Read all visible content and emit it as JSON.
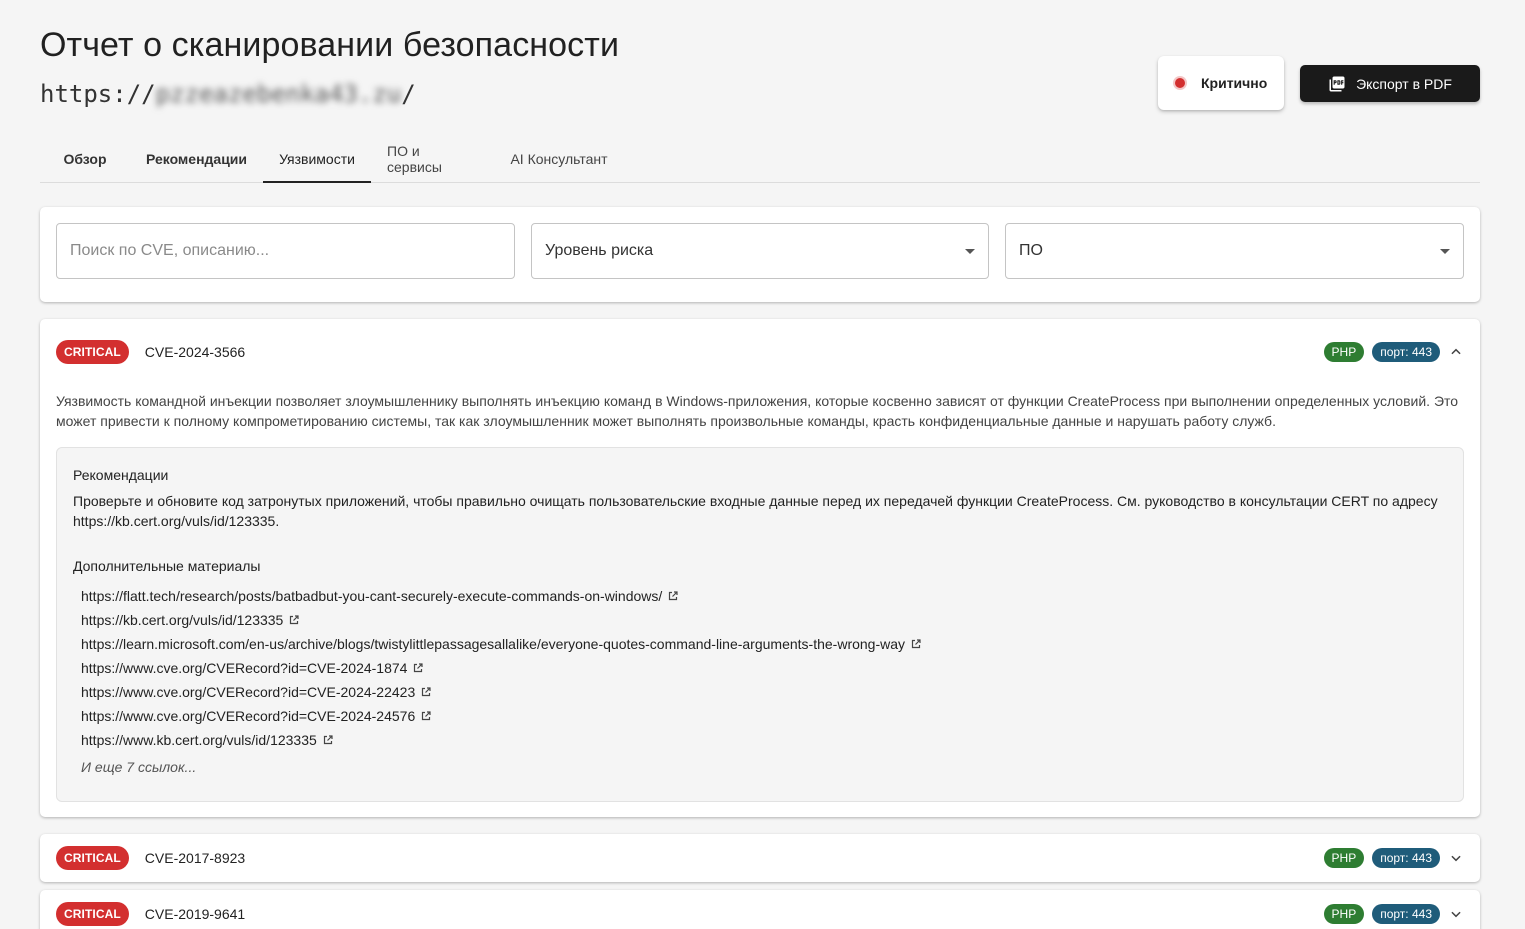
{
  "header": {
    "title": "Отчет о сканировании безопасности",
    "url_prefix": "https://",
    "url_hidden": "pzzeazebenka43.zu",
    "url_suffix": "/",
    "status": "Критично",
    "status_color": "#d32f2f",
    "export_label": "Экспорт в PDF"
  },
  "tabs": [
    "Обзор",
    "Рекомендации",
    "Уязвимости",
    "ПО и сервисы",
    "AI Консультант"
  ],
  "active_tab": "Уязвимости",
  "filters": {
    "search_placeholder": "Поиск по CVE, описанию...",
    "risk_label": "Уровень риска",
    "software_label": "ПО"
  },
  "vulnerabilities": [
    {
      "severity": "CRITICAL",
      "cve": "CVE-2024-3566",
      "software": "PHP",
      "port": "порт: 443",
      "expanded": true,
      "description": "Уязвимость командной инъекции позволяет злоумышленнику выполнять инъекцию команд в Windows-приложения, которые косвенно зависят от функции CreateProcess при выполнении определенных условий. Это может привести к полному компрометированию системы, так как злоумышленник может выполнять произвольные команды, красть конфиденциальные данные и нарушать работу служб.",
      "recommendations_title": "Рекомендации",
      "recommendations": "Проверьте и обновите код затронутых приложений, чтобы правильно очищать пользовательские входные данные перед их передачей функции CreateProcess. См. руководство в консультации CERT по адресу https://kb.cert.org/vuls/id/123335.",
      "materials_title": "Дополнительные материалы",
      "links": [
        "https://flatt.tech/research/posts/batbadbut-you-cant-securely-execute-commands-on-windows/",
        "https://kb.cert.org/vuls/id/123335",
        "https://learn.microsoft.com/en-us/archive/blogs/twistylittlepassagesallalike/everyone-quotes-command-line-arguments-the-wrong-way",
        "https://www.cve.org/CVERecord?id=CVE-2024-1874",
        "https://www.cve.org/CVERecord?id=CVE-2024-22423",
        "https://www.cve.org/CVERecord?id=CVE-2024-24576",
        "https://www.kb.cert.org/vuls/id/123335"
      ],
      "more_links": "И еще 7 ссылок..."
    },
    {
      "severity": "CRITICAL",
      "cve": "CVE-2017-8923",
      "software": "PHP",
      "port": "порт: 443",
      "expanded": false
    },
    {
      "severity": "CRITICAL",
      "cve": "CVE-2019-9641",
      "software": "PHP",
      "port": "порт: 443",
      "expanded": false
    }
  ],
  "colors": {
    "critical": "#d32f2f",
    "php_tag": "#2e7d32",
    "port_tag": "#1f5c7a",
    "export_button": "#1a1a1a"
  }
}
